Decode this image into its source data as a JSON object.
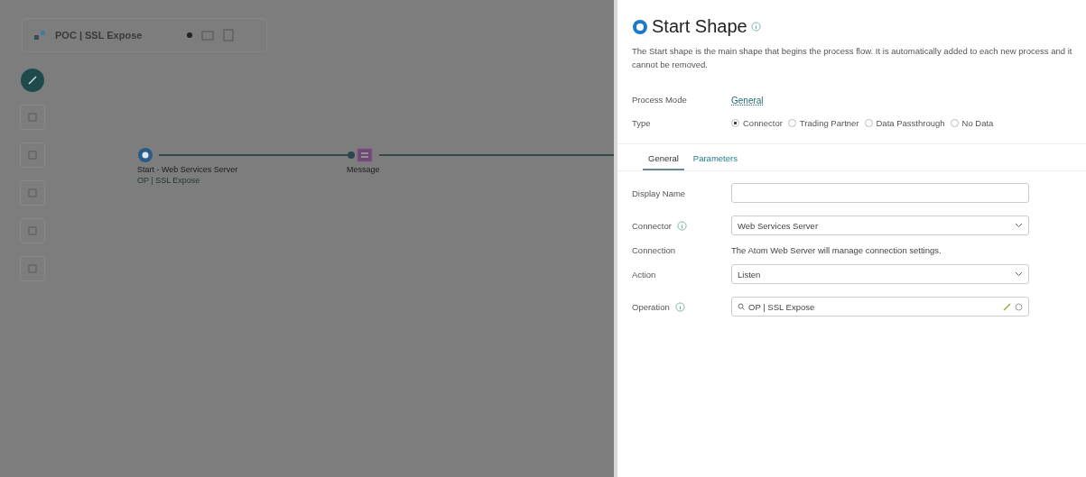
{
  "header": {
    "title": "POC | SSL Expose"
  },
  "canvas": {
    "nodes": [
      {
        "kind": "start",
        "label": "Start - Web Services Server",
        "sublabel": "OP | SSL Expose"
      },
      {
        "kind": "message",
        "label": "Message"
      }
    ]
  },
  "panel": {
    "title": "Start Shape",
    "description": "The Start shape is the main shape that begins the process flow. It is automatically added to each new process and it cannot be removed.",
    "process_mode": {
      "label": "Process Mode",
      "value": "General"
    },
    "type": {
      "label": "Type",
      "options": [
        {
          "label": "Connector",
          "selected": true
        },
        {
          "label": "Trading Partner",
          "selected": false
        },
        {
          "label": "Data Passthrough",
          "selected": false
        },
        {
          "label": "No Data",
          "selected": false
        }
      ]
    },
    "tabs": [
      {
        "label": "General",
        "selected": true
      },
      {
        "label": "Parameters",
        "selected": false
      }
    ],
    "fields": [
      {
        "kind": "input",
        "label": "Display Name",
        "info": false
      },
      {
        "kind": "select",
        "label": "Connector",
        "info": true,
        "value": "Web Services Server"
      },
      {
        "kind": "text",
        "label": "Connection",
        "info": false,
        "value": "The Atom Web Server will manage connection settings."
      },
      {
        "kind": "select",
        "label": "Action",
        "info": false,
        "value": "Listen"
      },
      {
        "kind": "lookup",
        "label": "Operation",
        "info": true,
        "value": "OP | SSL Expose"
      }
    ]
  }
}
